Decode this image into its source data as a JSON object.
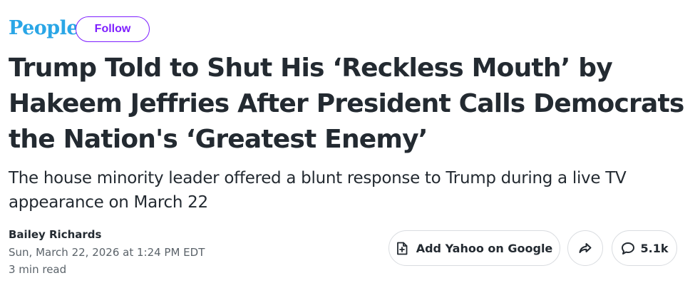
{
  "brand": {
    "name": "People",
    "color": "#2aa6e6"
  },
  "follow": {
    "label": "Follow",
    "color": "#7e1fff"
  },
  "article": {
    "headline": "Trump Told to Shut His ‘Reckless Mouth’ by Hakeem Jeffries After President Calls Democrats the Nation's ‘Greatest Enemy’",
    "subheadline": "The house minority leader offered a blunt response to Trump during a live TV appearance on March 22",
    "author": "Bailey Richards",
    "date": "Sun, March 22, 2026 at 1:24 PM EDT",
    "read_time": "3 min read"
  },
  "actions": {
    "add_google_label": "Add Yahoo on Google",
    "add_google_icon": "document-plus-icon",
    "share_icon": "share-arrow-icon",
    "comments_icon": "comment-bubble-icon",
    "comments_count": "5.1k"
  }
}
